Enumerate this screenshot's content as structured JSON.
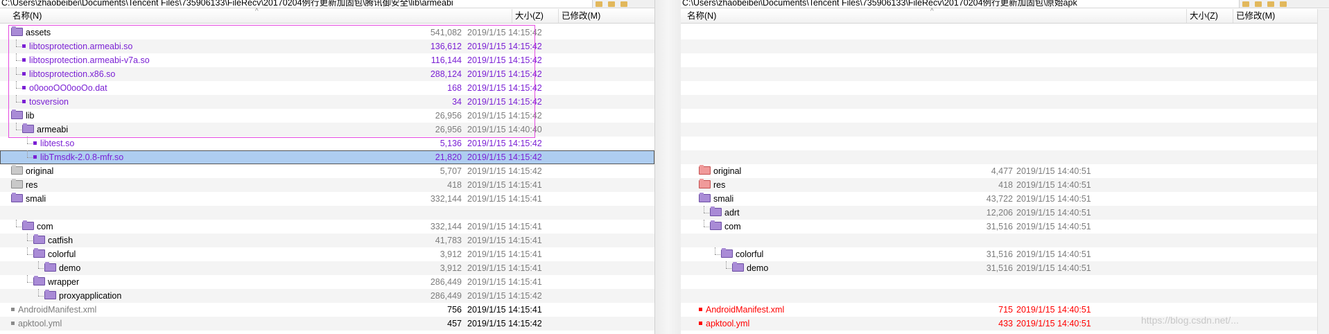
{
  "left": {
    "path": "C:\\Users\\zhaobeibei\\Documents\\Tencent Files\\735906133\\FileRecv\\20170204例行更新加固包\\腾讯御安全\\lib\\armeabi",
    "headers": {
      "name": "名称(N)",
      "size": "大小(Z)",
      "modified": "已修改(M)"
    },
    "rows": [
      {
        "name": "assets",
        "kind": "folder",
        "color": "black",
        "icon": "purple",
        "depth": 0,
        "size": "541,082",
        "size_color": "gray",
        "date": "2019/1/15 14:15:42",
        "date_color": "gray"
      },
      {
        "name": "libtosprotection.armeabi.so",
        "kind": "file",
        "color": "purple",
        "depth": 1,
        "size": "136,612",
        "size_color": "purple",
        "date": "2019/1/15 14:15:42",
        "date_color": "purple"
      },
      {
        "name": "libtosprotection.armeabi-v7a.so",
        "kind": "file",
        "color": "purple",
        "depth": 1,
        "size": "116,144",
        "size_color": "purple",
        "date": "2019/1/15 14:15:42",
        "date_color": "purple"
      },
      {
        "name": "libtosprotection.x86.so",
        "kind": "file",
        "color": "purple",
        "depth": 1,
        "size": "288,124",
        "size_color": "purple",
        "date": "2019/1/15 14:15:42",
        "date_color": "purple"
      },
      {
        "name": "o0oooOO0ooOo.dat",
        "kind": "file",
        "color": "purple",
        "depth": 1,
        "size": "168",
        "size_color": "purple",
        "date": "2019/1/15 14:15:42",
        "date_color": "purple"
      },
      {
        "name": "tosversion",
        "kind": "file",
        "color": "purple",
        "depth": 1,
        "size": "34",
        "size_color": "purple",
        "date": "2019/1/15 14:15:42",
        "date_color": "purple"
      },
      {
        "name": "lib",
        "kind": "folder",
        "color": "black",
        "icon": "purple",
        "depth": 0,
        "size": "26,956",
        "size_color": "gray",
        "date": "2019/1/15 14:15:42",
        "date_color": "gray"
      },
      {
        "name": "armeabi",
        "kind": "folder",
        "color": "black",
        "icon": "purple",
        "depth": 1,
        "size": "26,956",
        "size_color": "gray",
        "date": "2019/1/15 14:40:40",
        "date_color": "gray"
      },
      {
        "name": "libtest.so",
        "kind": "file",
        "color": "purple",
        "depth": 2,
        "size": "5,136",
        "size_color": "purple",
        "date": "2019/1/15 14:15:42",
        "date_color": "purple"
      },
      {
        "name": "libTmsdk-2.0.8-mfr.so",
        "kind": "file",
        "color": "purple",
        "depth": 2,
        "size": "21,820",
        "size_color": "purple",
        "date": "2019/1/15 14:15:42",
        "date_color": "purple",
        "selected": true
      },
      {
        "name": "original",
        "kind": "folder",
        "color": "black",
        "icon": "gray",
        "depth": 0,
        "size": "5,707",
        "size_color": "gray",
        "date": "2019/1/15 14:15:42",
        "date_color": "gray"
      },
      {
        "name": "res",
        "kind": "folder",
        "color": "black",
        "icon": "gray",
        "depth": 0,
        "size": "418",
        "size_color": "gray",
        "date": "2019/1/15 14:15:41",
        "date_color": "gray"
      },
      {
        "name": "smali",
        "kind": "folder",
        "color": "black",
        "icon": "purple",
        "depth": 0,
        "size": "332,144",
        "size_color": "gray",
        "date": "2019/1/15 14:15:41",
        "date_color": "gray"
      },
      {
        "name": "",
        "kind": "blank",
        "depth": 1
      },
      {
        "name": "com",
        "kind": "folder",
        "color": "black",
        "icon": "purple",
        "depth": 1,
        "size": "332,144",
        "size_color": "gray",
        "date": "2019/1/15 14:15:41",
        "date_color": "gray"
      },
      {
        "name": "catfish",
        "kind": "folder",
        "color": "black",
        "icon": "purple",
        "depth": 2,
        "size": "41,783",
        "size_color": "gray",
        "date": "2019/1/15 14:15:41",
        "date_color": "gray"
      },
      {
        "name": "colorful",
        "kind": "folder",
        "color": "black",
        "icon": "purple",
        "depth": 2,
        "size": "3,912",
        "size_color": "gray",
        "date": "2019/1/15 14:15:41",
        "date_color": "gray"
      },
      {
        "name": "demo",
        "kind": "folder",
        "color": "black",
        "icon": "purple",
        "depth": 3,
        "size": "3,912",
        "size_color": "gray",
        "date": "2019/1/15 14:15:41",
        "date_color": "gray"
      },
      {
        "name": "wrapper",
        "kind": "folder",
        "color": "black",
        "icon": "purple",
        "depth": 2,
        "size": "286,449",
        "size_color": "gray",
        "date": "2019/1/15 14:15:41",
        "date_color": "gray"
      },
      {
        "name": "proxyapplication",
        "kind": "folder",
        "color": "black",
        "icon": "purple",
        "depth": 3,
        "size": "286,449",
        "size_color": "gray",
        "date": "2019/1/15 14:15:42",
        "date_color": "gray"
      },
      {
        "name": "AndroidManifest.xml",
        "kind": "file",
        "color": "gray",
        "depth": 0,
        "size": "756",
        "size_color": "black",
        "date": "2019/1/15 14:15:41",
        "date_color": "black"
      },
      {
        "name": "apktool.yml",
        "kind": "file",
        "color": "gray",
        "depth": 0,
        "size": "457",
        "size_color": "black",
        "date": "2019/1/15 14:15:42",
        "date_color": "black"
      }
    ]
  },
  "right": {
    "path": "C:\\Users\\zhaobeibei\\Documents\\Tencent Files\\735906133\\FileRecv\\20170204例行更新加固包\\原始apk",
    "headers": {
      "name": "名称(N)",
      "size": "大小(Z)",
      "modified": "已修改(M)"
    },
    "rows": [
      {
        "kind": "blank"
      },
      {
        "kind": "blank"
      },
      {
        "kind": "blank"
      },
      {
        "kind": "blank"
      },
      {
        "kind": "blank"
      },
      {
        "kind": "blank"
      },
      {
        "kind": "blank"
      },
      {
        "kind": "blank"
      },
      {
        "kind": "blank"
      },
      {
        "kind": "blank"
      },
      {
        "name": "original",
        "kind": "folder",
        "color": "black",
        "icon": "pink",
        "depth": 0,
        "size": "4,477",
        "size_color": "gray",
        "date": "2019/1/15 14:40:51",
        "date_color": "gray"
      },
      {
        "name": "res",
        "kind": "folder",
        "color": "black",
        "icon": "pink",
        "depth": 0,
        "size": "418",
        "size_color": "gray",
        "date": "2019/1/15 14:40:51",
        "date_color": "gray"
      },
      {
        "name": "smali",
        "kind": "folder",
        "color": "black",
        "icon": "purple",
        "depth": 0,
        "size": "43,722",
        "size_color": "gray",
        "date": "2019/1/15 14:40:51",
        "date_color": "gray"
      },
      {
        "name": "adrt",
        "kind": "folder",
        "color": "black",
        "icon": "purple",
        "depth": 1,
        "size": "12,206",
        "size_color": "gray",
        "date": "2019/1/15 14:40:51",
        "date_color": "gray"
      },
      {
        "name": "com",
        "kind": "folder",
        "color": "black",
        "icon": "purple",
        "depth": 1,
        "size": "31,516",
        "size_color": "gray",
        "date": "2019/1/15 14:40:51",
        "date_color": "gray"
      },
      {
        "kind": "blank",
        "depth": 2
      },
      {
        "name": "colorful",
        "kind": "folder",
        "color": "black",
        "icon": "purple",
        "depth": 2,
        "size": "31,516",
        "size_color": "gray",
        "date": "2019/1/15 14:40:51",
        "date_color": "gray"
      },
      {
        "name": "demo",
        "kind": "folder",
        "color": "black",
        "icon": "purple",
        "depth": 3,
        "size": "31,516",
        "size_color": "gray",
        "date": "2019/1/15 14:40:51",
        "date_color": "gray"
      },
      {
        "kind": "blank"
      },
      {
        "kind": "blank"
      },
      {
        "name": "AndroidManifest.xml",
        "kind": "file",
        "color": "red",
        "depth": 0,
        "size": "715",
        "size_color": "red",
        "date": "2019/1/15 14:40:51",
        "date_color": "red"
      },
      {
        "name": "apktool.yml",
        "kind": "file",
        "color": "red",
        "depth": 0,
        "size": "433",
        "size_color": "red",
        "date": "2019/1/15 14:40:51",
        "date_color": "red"
      }
    ]
  },
  "watermark": "https://blog.csdn.net/..."
}
